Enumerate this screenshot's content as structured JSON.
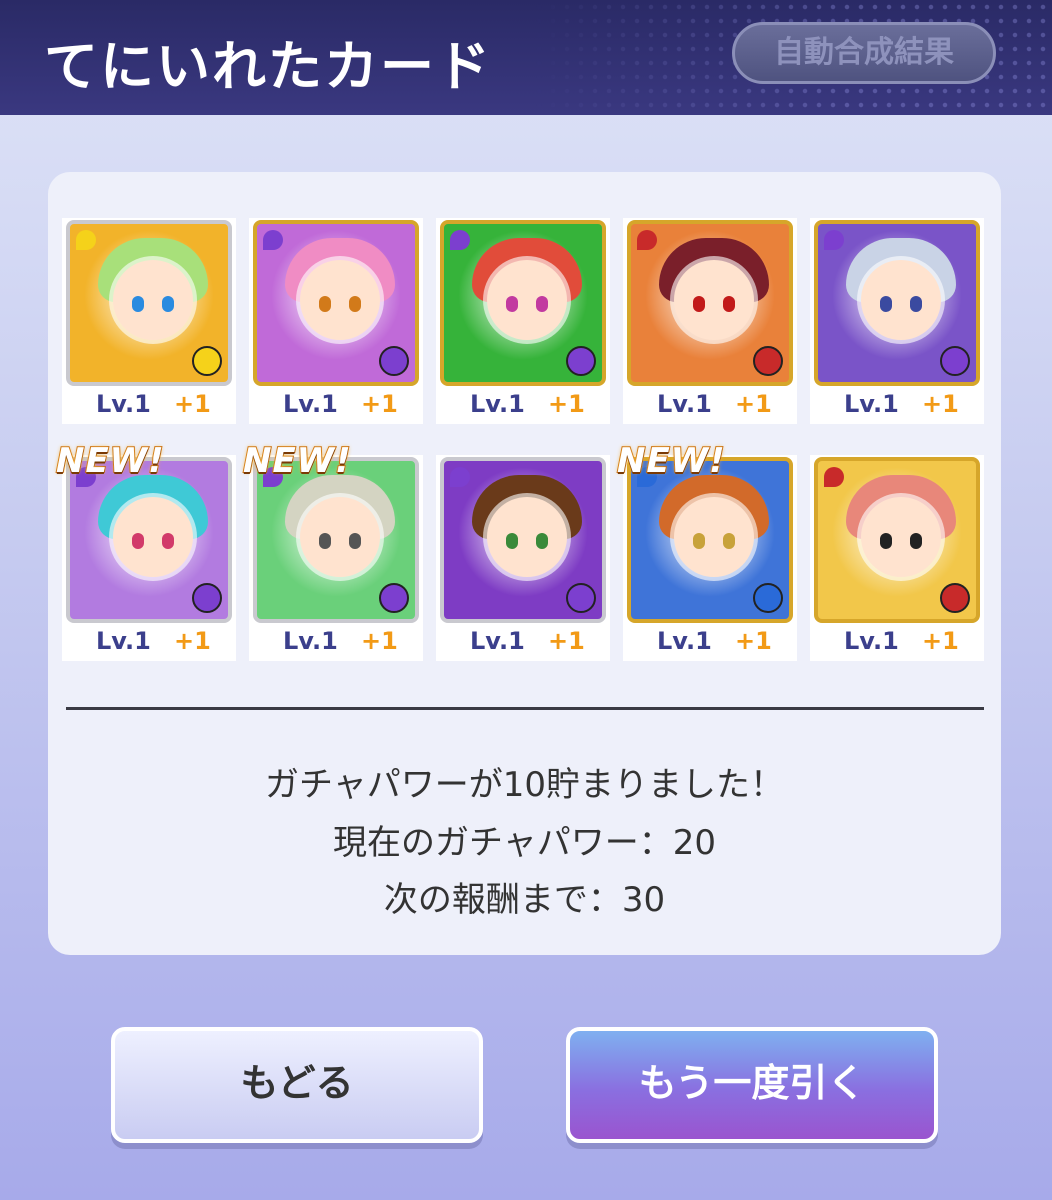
{
  "header": {
    "title": "てにいれたカード",
    "auto_button": "自動合成結果"
  },
  "cards": [
    {
      "level": "Lv.1",
      "plus": "+1",
      "new": "",
      "bg": "#f2b32a",
      "hair": "#a8e07a",
      "frame": "silver",
      "orb": "#f5d21a",
      "eye": "#2a8be0"
    },
    {
      "level": "Lv.1",
      "plus": "+1",
      "new": "",
      "bg": "#c06ad8",
      "hair": "#f08cc4",
      "frame": "gold",
      "orb": "#7c3fcf",
      "eye": "#d27a1a"
    },
    {
      "level": "Lv.1",
      "plus": "+1",
      "new": "",
      "bg": "#36b33a",
      "hair": "#e14c3a",
      "frame": "gold",
      "orb": "#7c3fcf",
      "eye": "#c23aa0"
    },
    {
      "level": "Lv.1",
      "plus": "+1",
      "new": "",
      "bg": "#e9813a",
      "hair": "#7a1f2a",
      "frame": "gold",
      "orb": "#c82a2a",
      "eye": "#c21a1a"
    },
    {
      "level": "Lv.1",
      "plus": "+1",
      "new": "",
      "bg": "#7a54c8",
      "hair": "#c9d3e6",
      "frame": "gold",
      "orb": "#7c3fcf",
      "eye": "#3a4aa0"
    },
    {
      "level": "Lv.1",
      "plus": "+1",
      "new": "NEW!",
      "bg": "#b27be0",
      "hair": "#3fc9d6",
      "frame": "silver",
      "orb": "#7c3fcf",
      "eye": "#d23a6a"
    },
    {
      "level": "Lv.1",
      "plus": "+1",
      "new": "NEW!",
      "bg": "#6ad07a",
      "hair": "#d4d4c2",
      "frame": "silver",
      "orb": "#7c3fcf",
      "eye": "#555555"
    },
    {
      "level": "Lv.1",
      "plus": "+1",
      "new": "",
      "bg": "#7e3cc4",
      "hair": "#6a3a1a",
      "frame": "silver",
      "orb": "#7c3fcf",
      "eye": "#3a8a3a"
    },
    {
      "level": "Lv.1",
      "plus": "+1",
      "new": "NEW!",
      "bg": "#3f74d8",
      "hair": "#d26a2a",
      "frame": "gold",
      "orb": "#2a6ad8",
      "eye": "#c8a23a"
    },
    {
      "level": "Lv.1",
      "plus": "+1",
      "new": "",
      "bg": "#f2c74a",
      "hair": "#e8877a",
      "frame": "gold",
      "orb": "#c82a2a",
      "eye": "#222222"
    }
  ],
  "messages": {
    "line1": "ガチャパワーが10貯まりました！",
    "line2": "現在のガチャパワー：20",
    "line3": "次の報酬まで：30"
  },
  "buttons": {
    "back": "もどる",
    "again": "もう一度引く"
  }
}
